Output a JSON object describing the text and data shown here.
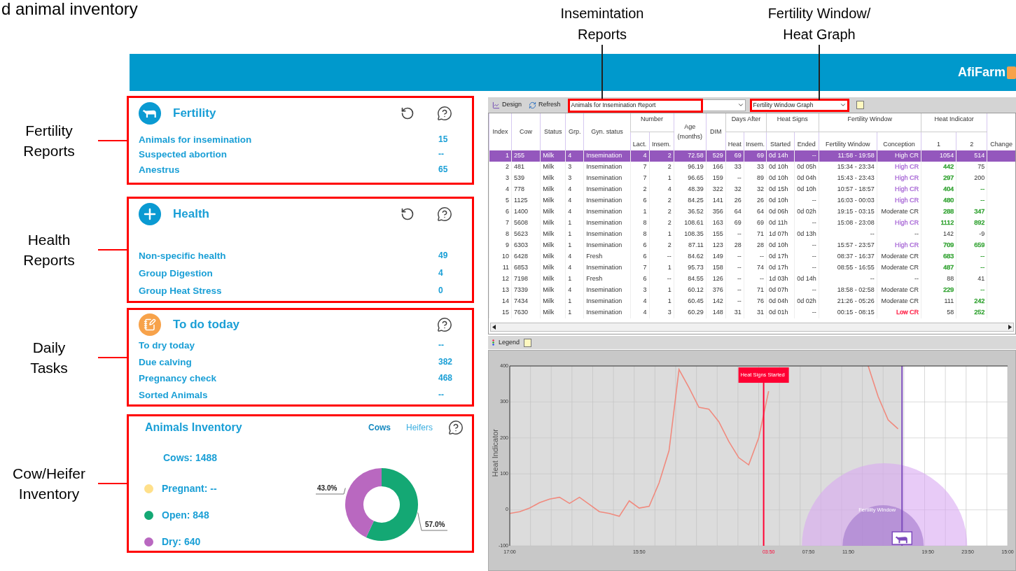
{
  "slide_title": "d animal inventory",
  "callouts": [
    {
      "lines": [
        "Insemintation",
        "Reports"
      ]
    },
    {
      "lines": [
        "Fertility Window/",
        "Heat Graph"
      ]
    }
  ],
  "header": {
    "logo": "AfiFarm"
  },
  "sections": [
    {
      "annotation": [
        "Fertility",
        "Reports"
      ],
      "panel": {
        "kind": "list",
        "title": "Fertility",
        "refresh": true,
        "items": [
          {
            "label": "Animals for insemination",
            "value": "15"
          },
          {
            "label": "Suspected abortion",
            "value": "--"
          },
          {
            "label": "Anestrus",
            "value": "65"
          }
        ]
      }
    },
    {
      "annotation": [
        "Health",
        "Reports"
      ],
      "panel": {
        "kind": "list",
        "title": "Health",
        "refresh": true,
        "items": [
          {
            "label": "Non-specific health",
            "value": "49"
          },
          {
            "label": "Group Digestion",
            "value": "4"
          },
          {
            "label": "Group Heat Stress",
            "value": "0"
          }
        ]
      }
    },
    {
      "annotation": [
        "Daily",
        "Tasks"
      ],
      "panel": {
        "kind": "list",
        "title": "To do today",
        "refresh": false,
        "items": [
          {
            "label": "To dry today",
            "value": "--"
          },
          {
            "label": "Due calving",
            "value": "382"
          },
          {
            "label": "Pregnancy check",
            "value": "468"
          },
          {
            "label": "Sorted Animals",
            "value": "--"
          }
        ]
      }
    },
    {
      "annotation": [
        "Cow/Heifer",
        "Inventory"
      ],
      "panel": {
        "kind": "inventory",
        "title": "Animals Inventory",
        "tabs": [
          {
            "label": "Cows",
            "selected": true
          },
          {
            "label": "Heifers",
            "selected": false
          }
        ],
        "total": "Cows: 1488",
        "legend": [
          {
            "label": "Pregnant: --",
            "color": "#ffe08a"
          },
          {
            "label": "Open: 848",
            "color": "#14a874"
          },
          {
            "label": "Dry: 640",
            "color": "#b968c0"
          }
        ],
        "chart_data": {
          "type": "donut",
          "values": [
            57.0,
            43.0
          ],
          "colors": [
            "#14a874",
            "#b968c0"
          ],
          "value_labels": [
            "57.0%",
            "43.0%"
          ]
        }
      }
    }
  ],
  "app": {
    "toolbar": {
      "buttons": [
        {
          "kind": "design",
          "label": "Design"
        },
        {
          "kind": "refresh",
          "label": "Refresh"
        }
      ],
      "report_select": "Animals for Insemination Report",
      "graph_select": "Fertility Window Graph"
    },
    "table": {
      "groups": [
        "Number",
        "Days After",
        "Heat Signs",
        "Fertility Window",
        "Heat Indicator"
      ],
      "columns": [
        "Index",
        "Cow",
        "Status",
        "Grp.",
        "Gyn. status",
        "Lact.",
        "Insem.",
        "Age (months)",
        "DIM",
        "Heat",
        "Insem.",
        "Started",
        "Ended",
        "Fertility Window",
        "Conception",
        "1",
        "2",
        "Change"
      ],
      "rows": [
        {
          "selected": true,
          "cells": [
            "1",
            "255",
            "Milk",
            "4",
            "Insemination",
            "4",
            "2",
            "72.58",
            "529",
            "69",
            "69",
            "0d 14h",
            "--",
            "11:58 - 19:58",
            "High CR",
            "1054",
            "514"
          ]
        },
        {
          "selected": false,
          "cells": [
            "2",
            "481",
            "Milk",
            "3",
            "Insemination",
            "7",
            "2",
            "96.19",
            "166",
            "33",
            "33",
            "0d 10h",
            "0d 05h",
            "15:34 - 23:34",
            {
              "text": "High CR",
              "color": "#b57fdc"
            },
            {
              "text": "442",
              "color": "#3aa63a"
            },
            "75"
          ]
        },
        {
          "selected": false,
          "cells": [
            "3",
            "539",
            "Milk",
            "3",
            "Insemination",
            "7",
            "1",
            "96.65",
            "159",
            "--",
            "89",
            "0d 10h",
            "0d 04h",
            "15:43 - 23:43",
            {
              "text": "High CR",
              "color": "#b57fdc"
            },
            {
              "text": "297",
              "color": "#3aa63a"
            },
            "200"
          ]
        },
        {
          "selected": false,
          "cells": [
            "4",
            "778",
            "Milk",
            "4",
            "Insemination",
            "2",
            "4",
            "48.39",
            "322",
            "32",
            "32",
            "0d 15h",
            "0d 10h",
            "10:57 - 18:57",
            {
              "text": "High CR",
              "color": "#b57fdc"
            },
            {
              "text": "404",
              "color": "#3aa63a"
            },
            {
              "text": "--",
              "color": "#3aa63a"
            }
          ]
        },
        {
          "selected": false,
          "cells": [
            "5",
            "1125",
            "Milk",
            "4",
            "Insemination",
            "6",
            "2",
            "84.25",
            "141",
            "26",
            "26",
            "0d 10h",
            "--",
            "16:03 - 00:03",
            {
              "text": "High CR",
              "color": "#b57fdc"
            },
            {
              "text": "480",
              "color": "#3aa63a"
            },
            {
              "text": "--",
              "color": "#3aa63a"
            }
          ]
        },
        {
          "selected": false,
          "cells": [
            "6",
            "1400",
            "Milk",
            "4",
            "Insemination",
            "1",
            "2",
            "36.52",
            "356",
            "64",
            "64",
            "0d 06h",
            "0d 02h",
            "19:15 - 03:15",
            "Moderate CR",
            {
              "text": "288",
              "color": "#3aa63a"
            },
            {
              "text": "347",
              "color": "#3aa63a"
            }
          ]
        },
        {
          "selected": false,
          "cells": [
            "7",
            "5608",
            "Milk",
            "1",
            "Insemination",
            "8",
            "2",
            "108.61",
            "163",
            "69",
            "69",
            "0d 11h",
            "--",
            "15:08 - 23:08",
            {
              "text": "High CR",
              "color": "#b57fdc"
            },
            {
              "text": "1112",
              "color": "#3aa63a"
            },
            {
              "text": "892",
              "color": "#3aa63a"
            }
          ]
        },
        {
          "selected": false,
          "cells": [
            "8",
            "5623",
            "Milk",
            "1",
            "Insemination",
            "8",
            "1",
            "108.35",
            "155",
            "--",
            "71",
            "1d 07h",
            "0d 13h",
            "--",
            "--",
            "142",
            "-9"
          ]
        },
        {
          "selected": false,
          "cells": [
            "9",
            "6303",
            "Milk",
            "1",
            "Insemination",
            "6",
            "2",
            "87.11",
            "123",
            "28",
            "28",
            "0d 10h",
            "--",
            "15:57 - 23:57",
            {
              "text": "High CR",
              "color": "#b57fdc"
            },
            {
              "text": "709",
              "color": "#3aa63a"
            },
            {
              "text": "659",
              "color": "#3aa63a"
            }
          ]
        },
        {
          "selected": false,
          "cells": [
            "10",
            "6428",
            "Milk",
            "4",
            "Fresh",
            "6",
            "--",
            "84.62",
            "149",
            "--",
            "--",
            "0d 17h",
            "--",
            "08:37 - 16:37",
            "Moderate CR",
            {
              "text": "683",
              "color": "#3aa63a"
            },
            {
              "text": "--",
              "color": "#3aa63a"
            }
          ]
        },
        {
          "selected": false,
          "cells": [
            "11",
            "6853",
            "Milk",
            "4",
            "Insemination",
            "7",
            "1",
            "95.73",
            "158",
            "--",
            "74",
            "0d 17h",
            "--",
            "08:55 - 16:55",
            "Moderate CR",
            {
              "text": "487",
              "color": "#3aa63a"
            },
            {
              "text": "--",
              "color": "#3aa63a"
            }
          ]
        },
        {
          "selected": false,
          "cells": [
            "12",
            "7198",
            "Milk",
            "1",
            "Fresh",
            "6",
            "--",
            "84.55",
            "126",
            "--",
            "--",
            "1d 03h",
            "0d 14h",
            "--",
            "--",
            "88",
            "41"
          ]
        },
        {
          "selected": false,
          "cells": [
            "13",
            "7339",
            "Milk",
            "4",
            "Insemination",
            "3",
            "1",
            "60.12",
            "376",
            "--",
            "71",
            "0d 07h",
            "--",
            "18:58 - 02:58",
            "Moderate CR",
            {
              "text": "229",
              "color": "#3aa63a"
            },
            {
              "text": "--",
              "color": "#3aa63a"
            }
          ]
        },
        {
          "selected": false,
          "cells": [
            "14",
            "7434",
            "Milk",
            "1",
            "Insemination",
            "4",
            "1",
            "60.45",
            "142",
            "--",
            "76",
            "0d 04h",
            "0d 02h",
            "21:26 - 05:26",
            "Moderate CR",
            "111",
            {
              "text": "242",
              "color": "#3aa63a"
            }
          ]
        },
        {
          "selected": false,
          "cells": [
            "15",
            "7630",
            "Milk",
            "1",
            "Insemination",
            "4",
            "3",
            "60.29",
            "148",
            "31",
            "31",
            "0d 01h",
            "--",
            "00:15 - 08:15",
            {
              "text": "Low CR",
              "color": "#ff3b5c"
            },
            "58",
            {
              "text": "252",
              "color": "#3aa63a"
            }
          ]
        }
      ]
    },
    "legend_bar": {
      "label": "Legend"
    },
    "chart_data": {
      "type": "line",
      "ylabel": "Heat Indicator",
      "grid": true,
      "categories": [
        "17:00",
        null,
        null,
        null,
        null,
        null,
        null,
        null,
        null,
        null,
        null,
        null,
        null,
        "15:50",
        null,
        null,
        null,
        null,
        null,
        null,
        null,
        null,
        null,
        null,
        null,
        null,
        "03:50",
        null,
        null,
        null,
        "07:50",
        null,
        null,
        null,
        "11:50",
        null,
        null,
        null,
        null,
        null,
        null,
        null,
        "19:50",
        null,
        null,
        null,
        "23:50",
        null,
        null,
        null,
        "15:00"
      ],
      "ylim": [
        -100,
        400
      ],
      "yticks": [
        -100,
        0,
        100,
        200,
        300,
        400
      ],
      "series": [
        {
          "color": "#f08a7e",
          "values": [
            -10,
            -5,
            5,
            20,
            30,
            35,
            18,
            35,
            15,
            -5,
            -10,
            -18,
            25,
            5,
            10,
            75,
            165,
            390,
            340,
            285,
            280,
            245,
            190,
            145,
            125,
            200,
            330,
            null,
            null,
            null,
            null,
            null,
            null,
            null,
            null,
            null,
            400,
            315,
            250,
            225,
            null,
            null,
            null,
            null,
            null,
            null,
            null,
            null,
            null,
            null,
            null
          ]
        }
      ],
      "annotations": [
        "Heat Signs Started",
        "Fertility Window"
      ]
    }
  }
}
